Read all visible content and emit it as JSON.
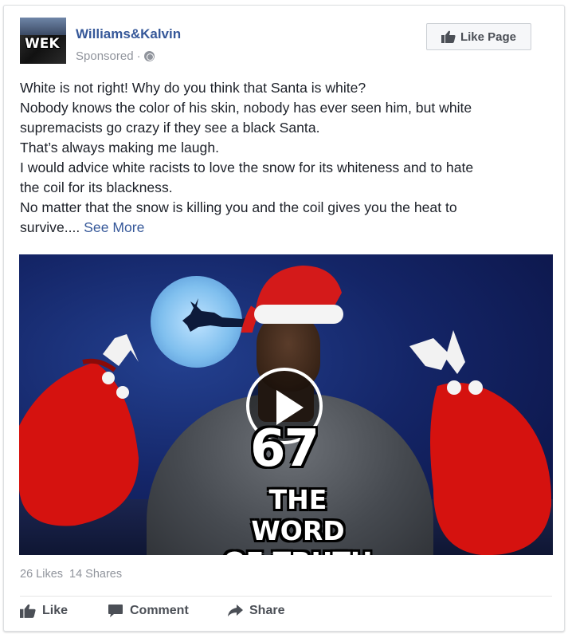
{
  "post": {
    "page_name": "Williams&Kalvin",
    "sponsored_label": "Sponsored",
    "meta_separator": "·",
    "avatar_logo_text": "WEK",
    "like_page_label": "Like Page",
    "text_lines": [
      "White is not right! Why do you think that Santa is white?",
      "Nobody knows the color of his skin, nobody has ever seen him, but white",
      "supremacists go crazy if they see a black Santa.",
      "That’s always making me laugh.",
      "I would advice white racists to love the snow for its whiteness and to hate",
      "the coil for its blackness.",
      "No matter that the snow is killing you and the coil gives you the heat to",
      "survive...."
    ],
    "see_more_label": "See More",
    "video": {
      "number": "67",
      "title_line1": "THE WORD",
      "title_line2": "OF TRUTH"
    },
    "stats": {
      "likes": "26 Likes",
      "shares": "14 Shares"
    },
    "actions": {
      "like": "Like",
      "comment": "Comment",
      "share": "Share"
    }
  },
  "colors": {
    "link_blue": "#365899",
    "meta_gray": "#90949c",
    "action_gray": "#4b4f56",
    "text": "#1d2129"
  }
}
